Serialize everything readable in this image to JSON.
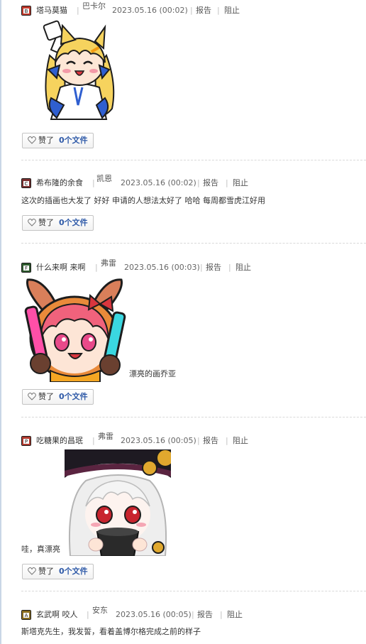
{
  "comments": [
    {
      "avatar_letter": "B",
      "avatar_color": "#c0392b",
      "username": "塔马莫猫",
      "sign": "巴卡尔",
      "date": "2023.05.16 (00:02)",
      "report": "报告",
      "block": "阻止",
      "text": "",
      "like_label": "赞了",
      "like_count": "0个文件"
    },
    {
      "avatar_letter": "C",
      "avatar_color": "#7a2f2f",
      "username": "希布隆的余食",
      "sign": "凯恩",
      "date": "2023.05.16 (00:02)",
      "report": "报告",
      "block": "阻止",
      "text": "这次的插画也大发了 好好 申请的人想法太好了 哈哈 每周都雪虎江好用",
      "like_label": "赞了",
      "like_count": "0个文件"
    },
    {
      "avatar_letter": "F",
      "avatar_color": "#2d5a2d",
      "username": "什么来啊 来啊",
      "sign": "弗雷",
      "date": "2023.05.16 (00:03)",
      "report": "报告",
      "block": "阻止",
      "text": "漂亮的画乔亚",
      "like_label": "赞了",
      "like_count": "0个文件"
    },
    {
      "avatar_letter": "P",
      "avatar_color": "#b03a2e",
      "username": "吃糖果的昌珉",
      "sign": "弗雷",
      "date": "2023.05.16 (00:05)",
      "report": "报告",
      "block": "阻止",
      "text": "哇，真漂亮",
      "like_label": "赞了",
      "like_count": "0个文件"
    },
    {
      "avatar_letter": "A",
      "avatar_color": "#8a6d1f",
      "username": "玄武啊 咬人",
      "sign": "安东",
      "date": "2023.05.16 (00:05)",
      "report": "报告",
      "block": "阻止",
      "text": "斯塔克先生，我发誓，看着盖博尔格完成之前的样子",
      "like_label": "",
      "like_count": ""
    }
  ],
  "icons": {
    "like": "heart-outline-icon",
    "sticker_1": "blonde-maid-cat-girl-sticker",
    "sticker_2": "bunny-girl-glowsticks-sticker",
    "sticker_3": "witch-girl-sticker"
  }
}
